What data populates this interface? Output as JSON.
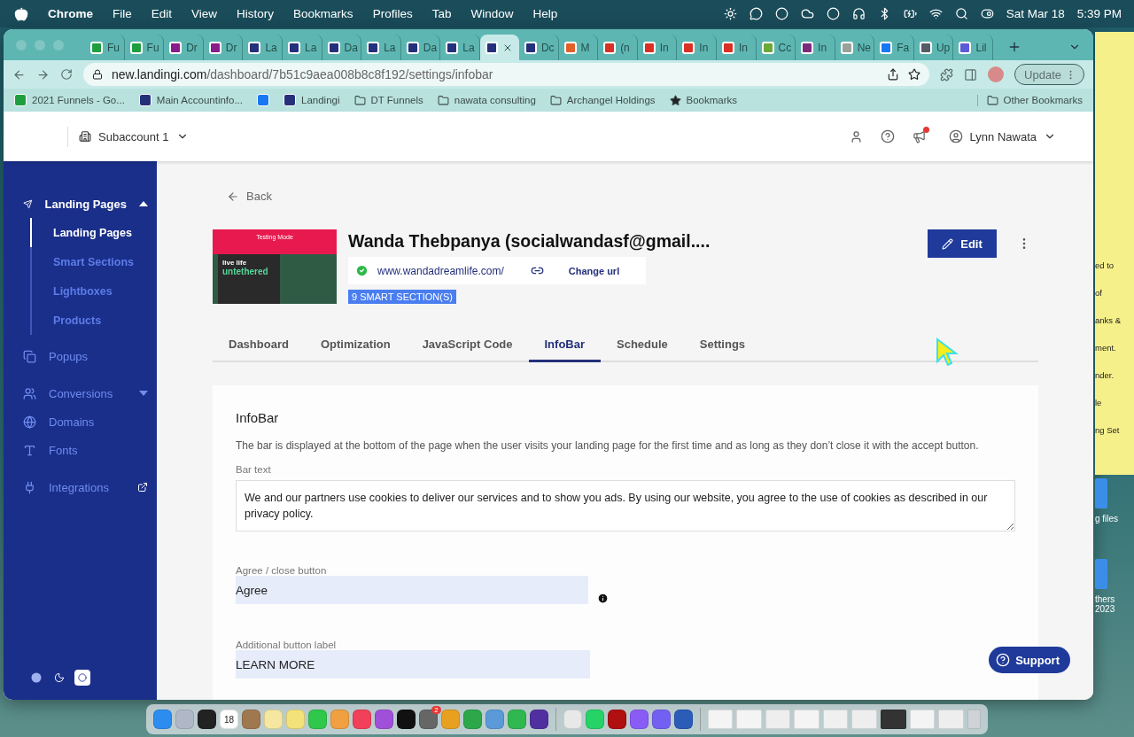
{
  "menu_bar": {
    "app": "Chrome",
    "menus": [
      "File",
      "Edit",
      "View",
      "History",
      "Bookmarks",
      "Profiles",
      "Tab",
      "Window",
      "Help"
    ],
    "date": "Sat Mar 18",
    "time": "5:39 PM"
  },
  "browser": {
    "tabs": [
      {
        "title": "Fu",
        "selected": false,
        "color": "#1e9e3e"
      },
      {
        "title": "Fu",
        "selected": false,
        "color": "#1e9e3e"
      },
      {
        "title": "Dr",
        "selected": false,
        "color": "#8a1b8a"
      },
      {
        "title": "Dr",
        "selected": false,
        "color": "#8a1b8a"
      },
      {
        "title": "La",
        "selected": false,
        "color": "#24307a"
      },
      {
        "title": "La",
        "selected": false,
        "color": "#24307a"
      },
      {
        "title": "Da",
        "selected": false,
        "color": "#24307a"
      },
      {
        "title": "La",
        "selected": false,
        "color": "#24307a"
      },
      {
        "title": "Da",
        "selected": false,
        "color": "#24307a"
      },
      {
        "title": "La",
        "selected": false,
        "color": "#24307a"
      },
      {
        "selected": true,
        "color": "#24307a"
      },
      {
        "title": "Dc",
        "selected": false,
        "color": "#24307a"
      },
      {
        "title": "M",
        "selected": false,
        "color": "#e0602a"
      },
      {
        "title": "(n",
        "selected": false,
        "color": "#d93025"
      },
      {
        "title": "In",
        "selected": false,
        "color": "#d93025"
      },
      {
        "title": "In",
        "selected": false,
        "color": "#d93025"
      },
      {
        "title": "In",
        "selected": false,
        "color": "#d93025"
      },
      {
        "title": "Cc",
        "selected": false,
        "color": "#6aa83a"
      },
      {
        "title": "In",
        "selected": false,
        "color": "#7b2a7a"
      },
      {
        "title": "Ne",
        "selected": false,
        "color": "#9aa09a"
      },
      {
        "title": "Fa",
        "selected": false,
        "color": "#1877f2"
      },
      {
        "title": "Up",
        "selected": false,
        "color": "#555b66"
      },
      {
        "title": "Lil",
        "selected": false,
        "color": "#5b5bd6"
      }
    ],
    "url_host": "new.landingi.com",
    "url_path": "/dashboard/7b51c9aea008b8c8f192/settings/infobar",
    "update_button": "Update",
    "bookmarks": [
      {
        "label": "2021 Funnels - Go...",
        "kind": "favicon",
        "color": "#1e9e3e"
      },
      {
        "label": "Main Accountinfo...",
        "kind": "favicon",
        "color": "#24307a"
      },
      {
        "kind": "favicon",
        "color": "#1877f2"
      },
      {
        "label": "Landingi",
        "kind": "favicon",
        "color": "#24307a"
      },
      {
        "label": "DT Funnels",
        "kind": "folder"
      },
      {
        "label": "nawata consulting",
        "kind": "folder"
      },
      {
        "label": "Archangel Holdings",
        "kind": "folder"
      },
      {
        "label": "Bookmarks",
        "kind": "star"
      }
    ],
    "other_bookmarks": "Other Bookmarks"
  },
  "app": {
    "subaccount": "Subaccount 1",
    "user": "Lynn Nawata",
    "notification": true,
    "sidebar": [
      {
        "label": "Landing Pages",
        "kind": "group",
        "expanded": true,
        "children": [
          {
            "label": "Landing Pages",
            "selected": true
          },
          {
            "label": "Smart Sections",
            "selected": false
          },
          {
            "label": "Lightboxes",
            "selected": false
          },
          {
            "label": "Products",
            "selected": false
          }
        ]
      },
      {
        "label": "Popups",
        "kind": "link"
      },
      {
        "label": "Conversions",
        "kind": "group",
        "expanded": false
      },
      {
        "label": "Domains",
        "kind": "link"
      },
      {
        "label": "Fonts",
        "kind": "link"
      },
      {
        "label": "Integrations",
        "kind": "external"
      }
    ],
    "theme_buttons": [
      {
        "kind": "dark",
        "selected": false
      },
      {
        "kind": "light",
        "selected": true
      }
    ],
    "back": "Back",
    "preview": {
      "banner": "Testing Mode",
      "line1": "live life",
      "line2": "untethered"
    },
    "page_title": "Wanda Thebpanya (socialwandasf@gmail....",
    "published": true,
    "url": "www.wandadreamlife.com/",
    "change_url": "Change url",
    "badge": "9 SMART SECTION(S)",
    "edit_button": "Edit",
    "tabs": [
      {
        "label": "Dashboard",
        "selected": false
      },
      {
        "label": "Optimization",
        "selected": false
      },
      {
        "label": "JavaScript Code",
        "selected": false
      },
      {
        "label": "InfoBar",
        "selected": true
      },
      {
        "label": "Schedule",
        "selected": false
      },
      {
        "label": "Settings",
        "selected": false
      }
    ],
    "infobar": {
      "heading": "InfoBar",
      "description": "The bar is displayed at the bottom of the page when the user visits your landing page for the first time and as long as they don’t close it with the accept button.",
      "bar_text_label": "Bar text",
      "bar_text": "We and our partners use cookies to deliver our services and to show you ads. By using our website, you agree to the use of cookies as described in our privacy policy.",
      "agree_label": "Agree / close button",
      "agree_value": "Agree",
      "additional_label": "Additional button label",
      "additional_value": "LEARN MORE"
    },
    "support_button": "Support"
  },
  "desktop": {
    "note_lines": [
      "ed to",
      "of",
      "anks &",
      "ment.",
      "nder.",
      "le",
      "ng Set"
    ],
    "files": [
      "g files",
      "thers\n2023"
    ]
  },
  "dock": [
    {
      "kind": "app",
      "color": "#2d8cf0"
    },
    {
      "kind": "app",
      "color": "#b0b8c8"
    },
    {
      "kind": "app",
      "color": "#222222"
    },
    {
      "kind": "calendar",
      "color": "#ffffff",
      "date": "18"
    },
    {
      "kind": "app",
      "color": "#a07850"
    },
    {
      "kind": "app",
      "color": "#f5e7a0"
    },
    {
      "kind": "app",
      "color": "#f3e27a"
    },
    {
      "kind": "app",
      "color": "#2fc84a"
    },
    {
      "kind": "app",
      "color": "#f0a040"
    },
    {
      "kind": "app",
      "color": "#f2405a"
    },
    {
      "kind": "app",
      "color": "#a050d8"
    },
    {
      "kind": "app",
      "color": "#111111"
    },
    {
      "kind": "app",
      "color": "#666666",
      "badge": "2"
    },
    {
      "kind": "app",
      "color": "#e8a020"
    },
    {
      "kind": "app",
      "color": "#2ca84a"
    },
    {
      "kind": "app",
      "color": "#5a9ad8"
    },
    {
      "kind": "app",
      "color": "#30b850"
    },
    {
      "kind": "app",
      "color": "#5030a0"
    },
    {
      "kind": "separator"
    },
    {
      "kind": "app",
      "color": "#e8e8e8"
    },
    {
      "kind": "app",
      "color": "#25d366"
    },
    {
      "kind": "app",
      "color": "#b01010"
    },
    {
      "kind": "app",
      "color": "#8a5cf6"
    },
    {
      "kind": "app",
      "color": "#7360f2"
    },
    {
      "kind": "app",
      "color": "#2b5cb8"
    },
    {
      "kind": "separator"
    },
    {
      "kind": "window",
      "color": "#f4f4f4"
    },
    {
      "kind": "window",
      "color": "#f4f4f4"
    },
    {
      "kind": "window",
      "color": "#eeeeee"
    },
    {
      "kind": "window",
      "color": "#f4f4f4"
    },
    {
      "kind": "window",
      "color": "#f0f0f0"
    },
    {
      "kind": "window",
      "color": "#eeeeee"
    },
    {
      "kind": "window",
      "color": "#333333"
    },
    {
      "kind": "window",
      "color": "#f4f4f4"
    },
    {
      "kind": "window",
      "color": "#eeeeee"
    },
    {
      "kind": "trash",
      "color": "#cfd3d8"
    }
  ]
}
